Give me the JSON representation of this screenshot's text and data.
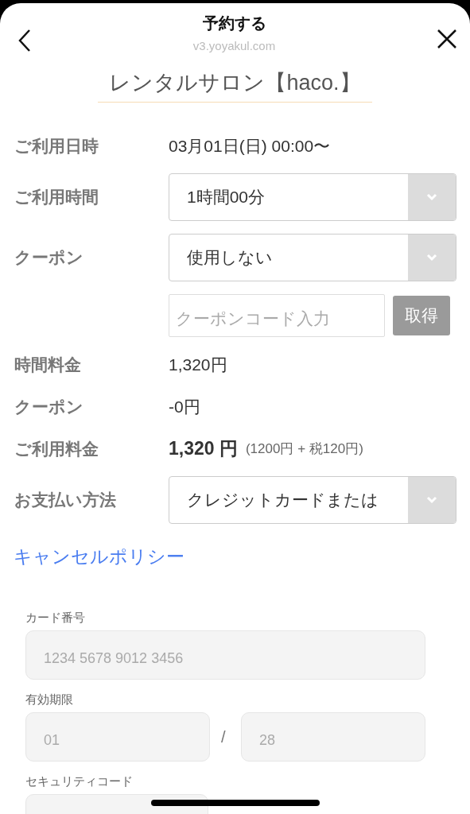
{
  "header": {
    "title": "予約する",
    "subtitle": "v3.yoyakul.com"
  },
  "shop_name": "レンタルサロン【haco.】",
  "rows": [
    {
      "kind": "text",
      "label": "ご利用日時",
      "value": "03月01日(日) 00:00〜"
    },
    {
      "kind": "select",
      "label": "ご利用時間",
      "value": "1時間00分"
    },
    {
      "kind": "select",
      "label": "クーポン",
      "value": "使用しない"
    },
    {
      "kind": "coupon",
      "placeholder": "クーポンコード入力",
      "button": "取得",
      "disabled": true
    },
    {
      "kind": "text",
      "label": "時間料金",
      "value": "1,320円"
    },
    {
      "kind": "text",
      "label": "クーポン",
      "value": "-0円"
    },
    {
      "kind": "total",
      "label": "ご利用料金",
      "value": "1,320 円",
      "note": "(1200円 + 税120円)"
    },
    {
      "kind": "select",
      "label": "お支払い方法",
      "value": "クレジットカードまたは"
    }
  ],
  "cancel_policy_link": "キャンセルポリシー",
  "card_form": {
    "number_label": "カード番号",
    "number_placeholder": "1234 5678 9012 3456",
    "expiry_label": "有効期限",
    "month_placeholder": "01",
    "separator": "/",
    "year_placeholder": "28",
    "cvc_label": "セキュリティコード"
  }
}
